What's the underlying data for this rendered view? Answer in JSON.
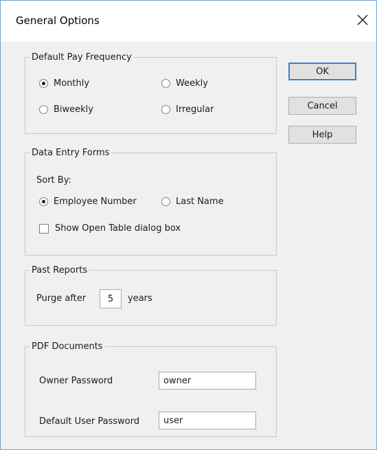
{
  "dialog": {
    "title": "General Options",
    "close_glyph": "✕"
  },
  "pay_frequency": {
    "legend": "Default Pay Frequency",
    "options": [
      {
        "label": "Monthly",
        "selected": true
      },
      {
        "label": "Weekly",
        "selected": false
      },
      {
        "label": "Biweekly",
        "selected": false
      },
      {
        "label": "Irregular",
        "selected": false
      }
    ]
  },
  "data_entry": {
    "legend": "Data Entry Forms",
    "sort_by_label": "Sort By:",
    "sort_options": [
      {
        "label": "Employee Number",
        "selected": true
      },
      {
        "label": "Last Name",
        "selected": false
      }
    ],
    "show_open_table": {
      "label": "Show Open Table dialog box",
      "checked": false
    }
  },
  "past_reports": {
    "legend": "Past Reports",
    "purge_prefix": "Purge after",
    "purge_value": "5",
    "purge_suffix": "years"
  },
  "pdf_documents": {
    "legend": "PDF Documents",
    "owner_password_label": "Owner Password",
    "owner_password_value": "owner",
    "user_password_label": "Default User Password",
    "user_password_value": "user"
  },
  "buttons": {
    "ok": "OK",
    "cancel": "Cancel",
    "help": "Help"
  },
  "colors": {
    "accent": "#3b7fd0",
    "window_border": "#6fa3d6",
    "client_bg": "#f0f0f0"
  }
}
